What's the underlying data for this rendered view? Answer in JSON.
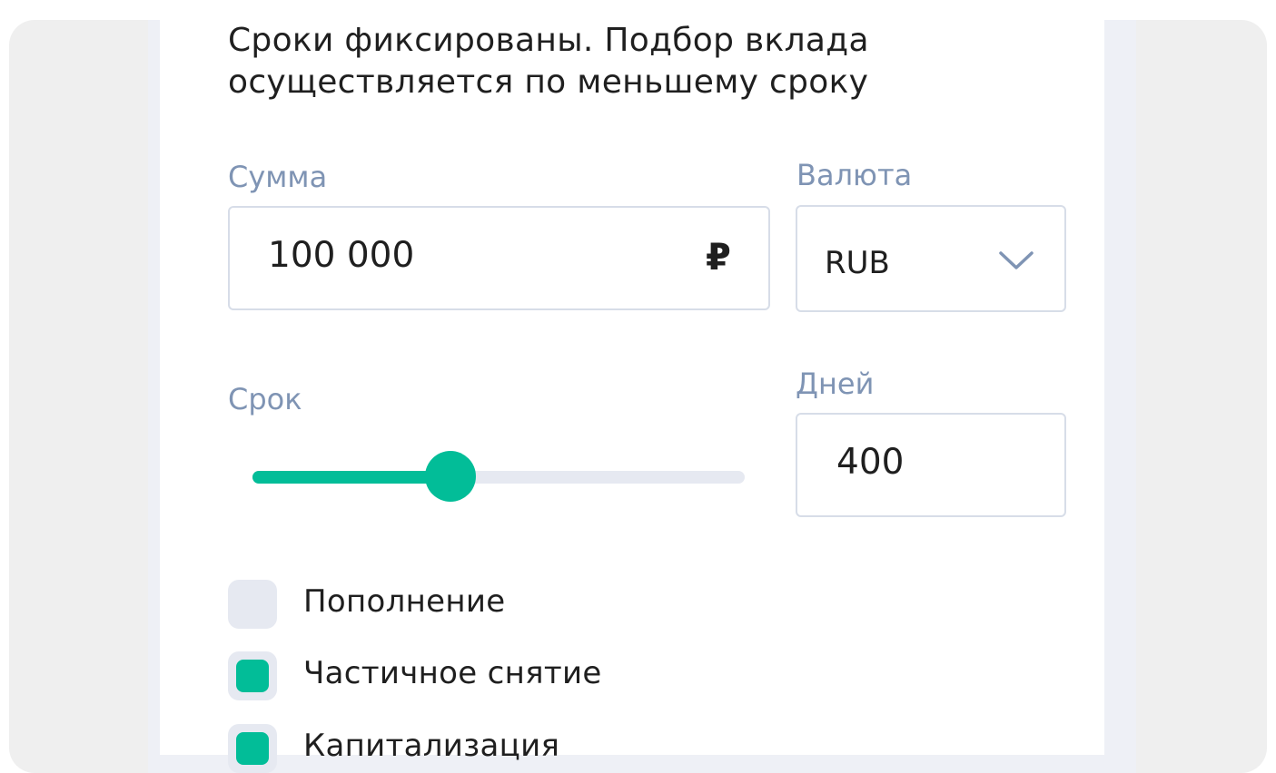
{
  "note": {
    "line1": "Сроки фиксированы. Подбор вклада",
    "line2": "осуществляется по меньшему сроку"
  },
  "amount": {
    "label": "Сумма",
    "value": "100 000",
    "currency_symbol": "₽"
  },
  "currency": {
    "label": "Валюта",
    "selected": "RUB",
    "icon": "chevron-down-icon"
  },
  "term": {
    "label": "Срок",
    "slider_fraction": 0.4
  },
  "days": {
    "label": "Дней",
    "value": "400"
  },
  "options": [
    {
      "label": "Пополнение",
      "checked": false
    },
    {
      "label": "Частичное снятие",
      "checked": true
    },
    {
      "label": "Капитализация",
      "checked": true
    }
  ],
  "colors": {
    "accent": "#02bd98",
    "label": "#7f94b4",
    "control_bg": "#e6e9f1"
  }
}
